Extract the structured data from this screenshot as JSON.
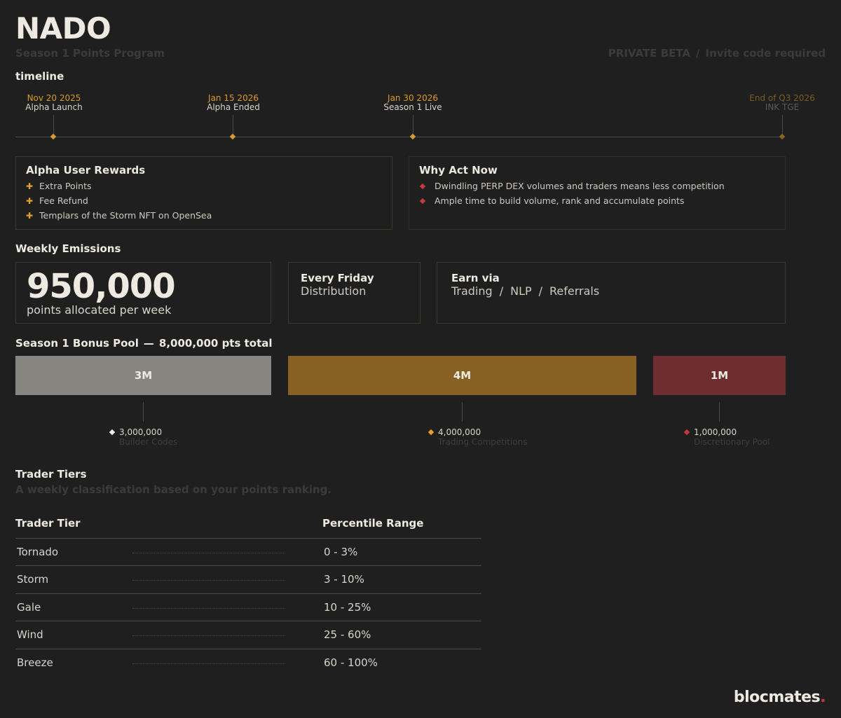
{
  "header": {
    "title": "NADO",
    "subtitle": "Season 1 Points Program",
    "beta_label": "PRIVATE BETA",
    "beta_separator": "/",
    "invite_label": "Invite code required"
  },
  "timeline": {
    "heading": "timeline",
    "milestones": [
      {
        "date": "Nov 20 2025",
        "label": "Alpha Launch"
      },
      {
        "date": "Jan 15 2026",
        "label": "Alpha Ended"
      },
      {
        "date": "Jan 30 2026",
        "label": "Season 1 Live"
      },
      {
        "date": "End of Q3 2026",
        "label": "INK TGE"
      }
    ]
  },
  "alpha_rewards": {
    "title": "Alpha User Rewards",
    "bullet_icon": "plus-icon",
    "items": [
      "Extra Points",
      "Fee Refund",
      "Templars of the Storm NFT on OpenSea"
    ]
  },
  "why_act": {
    "title": "Why Act Now",
    "bullet_icon": "diamond-icon",
    "items": [
      "Dwindling PERP DEX volumes and traders means less competition",
      "Ample time to build volume, rank and accumulate points"
    ]
  },
  "emissions": {
    "heading": "Weekly Emissions",
    "amount": "950,000",
    "amount_caption": "points allocated per week",
    "schedule_title": "Every Friday",
    "schedule_caption": "Distribution",
    "earn_title": "Earn via",
    "earn_methods": [
      "Trading",
      "NLP",
      "Referrals"
    ],
    "earn_separator": "/"
  },
  "bonus_pool": {
    "heading": "Season 1 Bonus Pool",
    "dash": "—",
    "total": "8,000,000 pts total",
    "segments": [
      {
        "short": "3M",
        "value": "3,000,000",
        "label": "Builder Codes",
        "color": "#878580",
        "dot": "#eee9e1"
      },
      {
        "short": "4M",
        "value": "4,000,000",
        "label": "Trading Competitions",
        "color": "#876023",
        "dot": "#e0a22c"
      },
      {
        "short": "1M",
        "value": "1,000,000",
        "label": "Discretionary Pool",
        "color": "#6c2e2e",
        "dot": "#c0393b"
      }
    ]
  },
  "tiers": {
    "heading": "Trader Tiers",
    "description": "A weekly classification based on your points ranking.",
    "col_tier": "Trader Tier",
    "col_range": "Percentile Range",
    "rows": [
      {
        "tier": "Tornado",
        "range": "0 - 3%"
      },
      {
        "tier": "Storm",
        "range": "3 - 10%"
      },
      {
        "tier": "Gale",
        "range": "10 - 25%"
      },
      {
        "tier": "Wind",
        "range": "25 - 60%"
      },
      {
        "tier": "Breeze",
        "range": "60 - 100%"
      }
    ]
  },
  "brand": {
    "name": "blocmates",
    "period": "."
  }
}
